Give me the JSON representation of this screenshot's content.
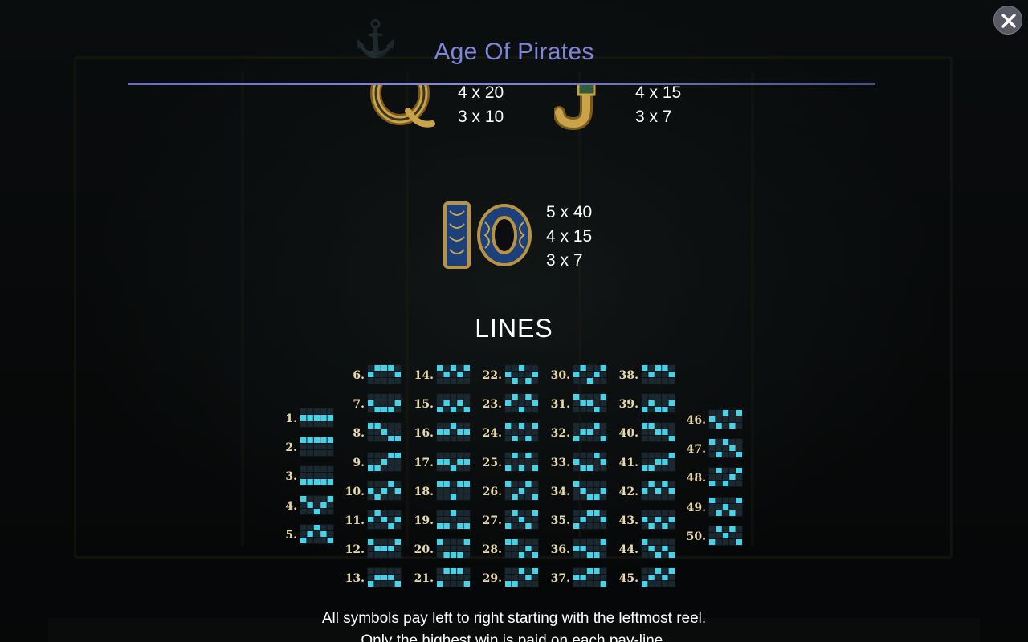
{
  "title": "Age Of Pirates",
  "colors": {
    "title": "#7f86d8",
    "line_active": "#44d3e8",
    "line_empty": "#1b2830"
  },
  "icons": {
    "close": "close-icon"
  },
  "symbols": [
    {
      "name": "symbol-q",
      "icon": "letter-q-icon",
      "pays": [
        "4 x 20",
        "3 x 10"
      ]
    },
    {
      "name": "symbol-j",
      "icon": "letter-j-icon",
      "pays": [
        "4 x 15",
        "3 x 7"
      ]
    },
    {
      "name": "symbol-10",
      "icon": "number-10-icon",
      "pays": [
        "5 x 40",
        "4 x 15",
        "3 x 7"
      ]
    }
  ],
  "lines_heading": "LINES",
  "paylines": [
    {
      "label": "1.",
      "rows": [
        1,
        1,
        1,
        1,
        1
      ]
    },
    {
      "label": "2.",
      "rows": [
        0,
        0,
        0,
        0,
        0
      ]
    },
    {
      "label": "3.",
      "rows": [
        2,
        2,
        2,
        2,
        2
      ]
    },
    {
      "label": "4.",
      "rows": [
        0,
        1,
        2,
        1,
        0
      ]
    },
    {
      "label": "5.",
      "rows": [
        2,
        1,
        0,
        1,
        2
      ]
    },
    {
      "label": "6.",
      "rows": [
        1,
        0,
        0,
        0,
        1
      ]
    },
    {
      "label": "7.",
      "rows": [
        1,
        2,
        2,
        2,
        1
      ]
    },
    {
      "label": "8.",
      "rows": [
        0,
        0,
        1,
        2,
        2
      ]
    },
    {
      "label": "9.",
      "rows": [
        2,
        2,
        1,
        0,
        0
      ]
    },
    {
      "label": "10.",
      "rows": [
        1,
        2,
        1,
        0,
        1
      ]
    },
    {
      "label": "11.",
      "rows": [
        1,
        0,
        1,
        2,
        1
      ]
    },
    {
      "label": "12.",
      "rows": [
        0,
        1,
        1,
        1,
        0
      ]
    },
    {
      "label": "13.",
      "rows": [
        2,
        1,
        1,
        1,
        2
      ]
    },
    {
      "label": "14.",
      "rows": [
        0,
        1,
        0,
        1,
        0
      ]
    },
    {
      "label": "15.",
      "rows": [
        2,
        1,
        2,
        1,
        2
      ]
    },
    {
      "label": "16.",
      "rows": [
        1,
        1,
        0,
        1,
        1
      ]
    },
    {
      "label": "17.",
      "rows": [
        1,
        1,
        2,
        1,
        1
      ]
    },
    {
      "label": "18.",
      "rows": [
        0,
        0,
        2,
        0,
        0
      ]
    },
    {
      "label": "19.",
      "rows": [
        2,
        2,
        0,
        2,
        2
      ]
    },
    {
      "label": "20.",
      "rows": [
        0,
        2,
        2,
        2,
        0
      ]
    },
    {
      "label": "21.",
      "rows": [
        2,
        0,
        0,
        0,
        2
      ]
    },
    {
      "label": "22.",
      "rows": [
        1,
        2,
        0,
        2,
        1
      ]
    },
    {
      "label": "23.",
      "rows": [
        1,
        0,
        2,
        0,
        1
      ]
    },
    {
      "label": "24.",
      "rows": [
        0,
        2,
        0,
        2,
        0
      ]
    },
    {
      "label": "25.",
      "rows": [
        2,
        0,
        2,
        0,
        2
      ]
    },
    {
      "label": "26.",
      "rows": [
        0,
        2,
        1,
        0,
        2
      ]
    },
    {
      "label": "27.",
      "rows": [
        2,
        0,
        1,
        2,
        0
      ]
    },
    {
      "label": "28.",
      "rows": [
        0,
        0,
        2,
        1,
        2
      ]
    },
    {
      "label": "29.",
      "rows": [
        2,
        2,
        0,
        1,
        0
      ]
    },
    {
      "label": "30.",
      "rows": [
        1,
        0,
        2,
        1,
        0
      ]
    },
    {
      "label": "31.",
      "rows": [
        0,
        1,
        1,
        2,
        0
      ]
    },
    {
      "label": "32.",
      "rows": [
        2,
        1,
        1,
        0,
        2
      ]
    },
    {
      "label": "33.",
      "rows": [
        1,
        2,
        2,
        0,
        1
      ]
    },
    {
      "label": "34.",
      "rows": [
        0,
        1,
        2,
        2,
        1
      ]
    },
    {
      "label": "35.",
      "rows": [
        2,
        1,
        0,
        0,
        1
      ]
    },
    {
      "label": "36.",
      "rows": [
        1,
        1,
        2,
        2,
        0
      ]
    },
    {
      "label": "37.",
      "rows": [
        1,
        1,
        0,
        0,
        2
      ]
    },
    {
      "label": "38.",
      "rows": [
        0,
        1,
        0,
        0,
        1
      ]
    },
    {
      "label": "39.",
      "rows": [
        2,
        1,
        2,
        2,
        1
      ]
    },
    {
      "label": "40.",
      "rows": [
        0,
        0,
        1,
        1,
        2
      ]
    },
    {
      "label": "41.",
      "rows": [
        2,
        2,
        1,
        1,
        0
      ]
    },
    {
      "label": "42.",
      "rows": [
        1,
        0,
        1,
        0,
        1
      ]
    },
    {
      "label": "43.",
      "rows": [
        1,
        2,
        1,
        2,
        1
      ]
    },
    {
      "label": "44.",
      "rows": [
        0,
        1,
        2,
        1,
        2
      ]
    },
    {
      "label": "45.",
      "rows": [
        2,
        1,
        0,
        1,
        0
      ]
    },
    {
      "label": "46.",
      "rows": [
        1,
        2,
        0,
        2,
        0
      ]
    },
    {
      "label": "47.",
      "rows": [
        0,
        2,
        0,
        1,
        2
      ]
    },
    {
      "label": "48.",
      "rows": [
        2,
        0,
        2,
        1,
        0
      ]
    },
    {
      "label": "49.",
      "rows": [
        0,
        2,
        1,
        2,
        0
      ]
    },
    {
      "label": "50.",
      "rows": [
        2,
        0,
        1,
        0,
        2
      ]
    }
  ],
  "info": [
    "All symbols pay left to right starting with the leftmost reel.",
    "Only the highest win is paid on each pay-line."
  ]
}
